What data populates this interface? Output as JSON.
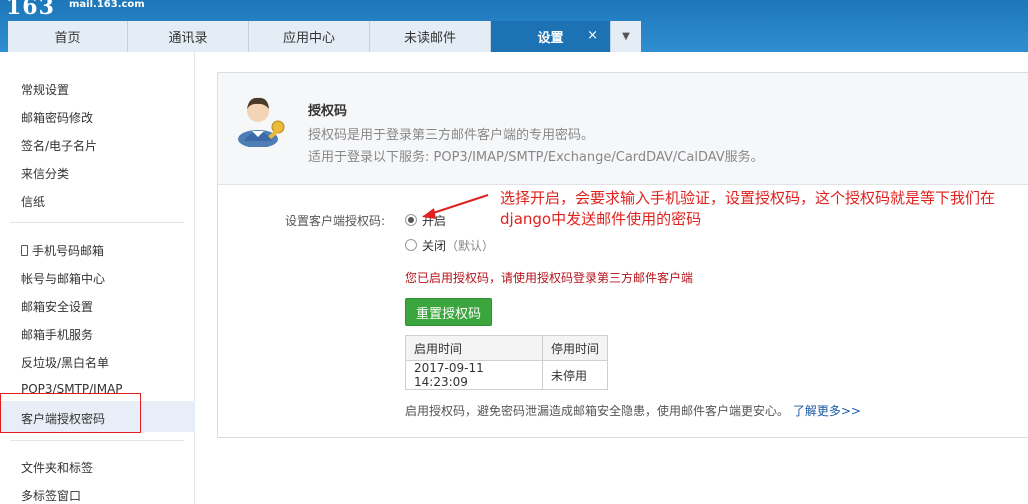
{
  "brand": {
    "logo": "163",
    "domain": "mail.163.com"
  },
  "tabs": [
    {
      "label": "首页"
    },
    {
      "label": "通讯录"
    },
    {
      "label": "应用中心"
    },
    {
      "label": "未读邮件"
    },
    {
      "label": "设置",
      "active": true,
      "close": "×"
    }
  ],
  "sidebar": {
    "group1": [
      "常规设置",
      "邮箱密码修改",
      "签名/电子名片",
      "来信分类",
      "信纸"
    ],
    "group2": [
      "手机号码邮箱",
      "帐号与邮箱中心",
      "邮箱安全设置",
      "邮箱手机服务",
      "反垃圾/黑白名单",
      "POP3/SMTP/IMAP",
      "客户端授权密码"
    ],
    "group3": [
      "文件夹和标签",
      "多标签窗口"
    ]
  },
  "panel": {
    "title": "授权码",
    "desc": "授权码是用于登录第三方邮件客户端的专用密码。",
    "services": "适用于登录以下服务: POP3/IMAP/SMTP/Exchange/CardDAV/CalDAV服务。",
    "field_label": "设置客户端授权码:",
    "option_on": "开启",
    "option_off": "关闭",
    "option_off_note": "（默认）",
    "notice": "您已启用授权码，请使用授权码登录第三方邮件客户端",
    "reset_button": "重置授权码",
    "table": {
      "headers": [
        "启用时间",
        "停用时间"
      ],
      "rows": [
        [
          "2017-09-11 14:23:09",
          "未停用"
        ]
      ]
    },
    "footer": "启用授权码，避免密码泄漏造成邮箱安全隐患，使用邮件客户端更安心。",
    "footer_link": "了解更多>>"
  },
  "annotation": "选择开启，会要求输入手机验证，设置授权码，这个授权码就是等下我们在django中发送邮件使用的密码",
  "colors": {
    "header": "#2f8ed1",
    "active_tab": "#1c72b3",
    "button": "#3aa63d",
    "annotation": "#e0211e"
  }
}
